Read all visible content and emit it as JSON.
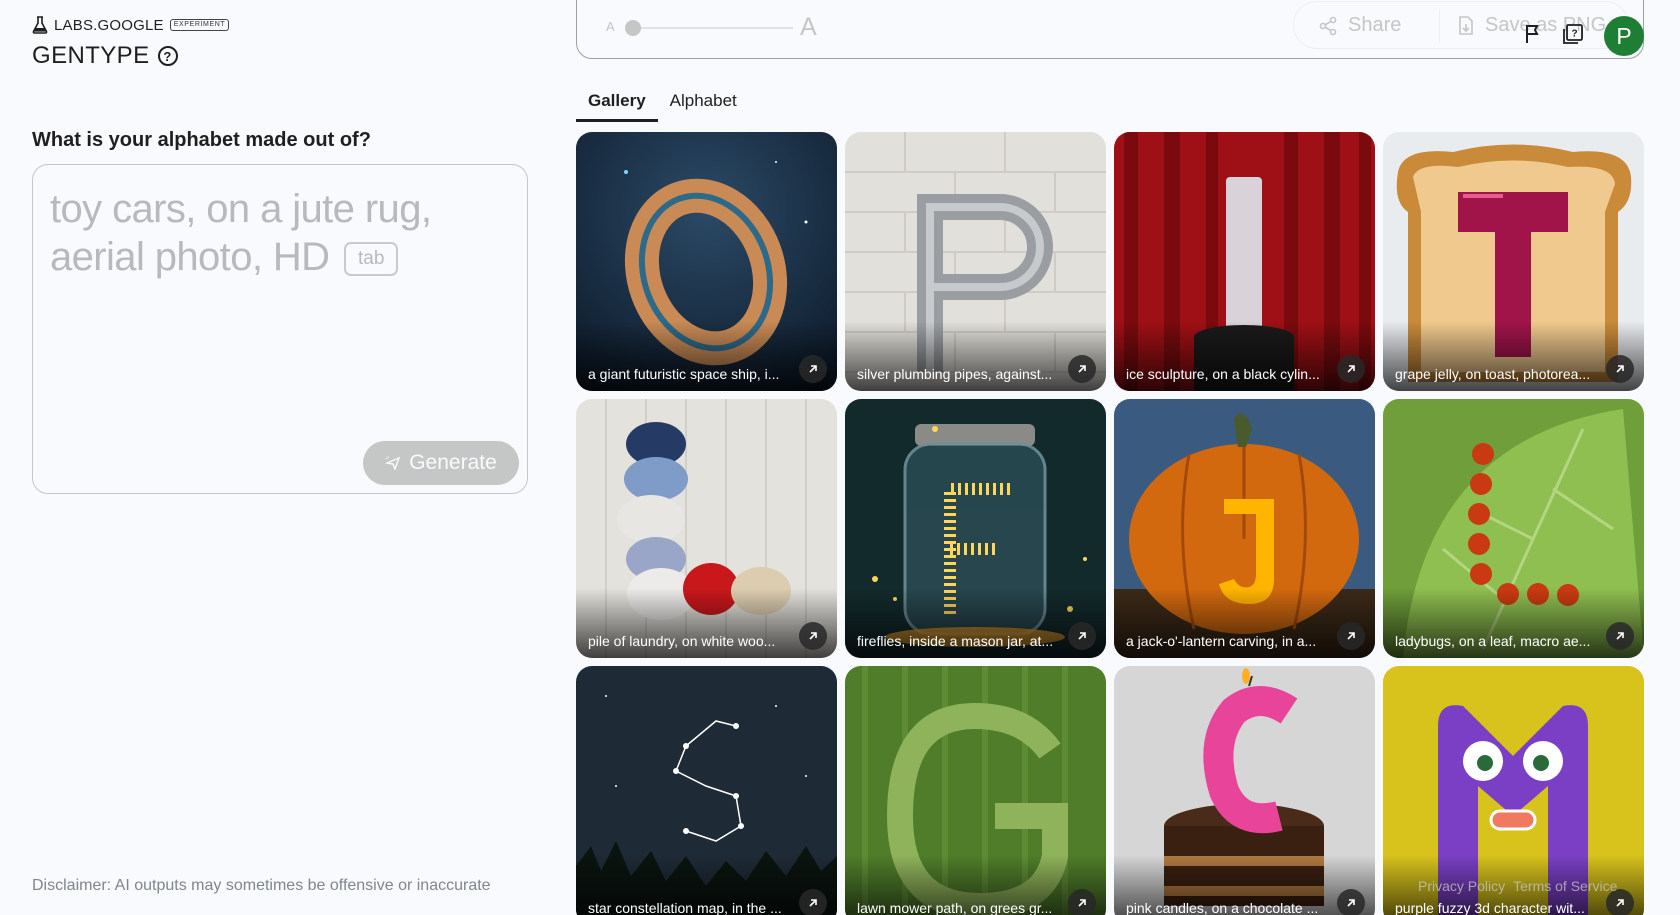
{
  "brand": {
    "name": "LABS.GOOGLE",
    "badge": "EXPERIMENT"
  },
  "app": {
    "title": "GENTYPE"
  },
  "prompt": {
    "question": "What is your alphabet made out of?",
    "placeholder": "toy cars, on a jute rug, aerial photo, HD",
    "tab_hint": "tab",
    "generate_label": "Generate"
  },
  "toolbar": {
    "size_small": "A",
    "size_large": "A",
    "size_level": 0.03,
    "share_label": "Share",
    "save_label": "Save as PNG"
  },
  "user": {
    "avatar_letter": "P"
  },
  "tabs": [
    {
      "label": "Gallery",
      "active": true
    },
    {
      "label": "Alphabet",
      "active": false
    }
  ],
  "gallery": [
    {
      "letter": "O",
      "caption": "a giant futuristic space ship, i..."
    },
    {
      "letter": "P",
      "caption": "silver plumbing pipes, against..."
    },
    {
      "letter": "I",
      "caption": "ice sculpture, on a black cylin..."
    },
    {
      "letter": "T",
      "caption": "grape jelly, on toast, photorea..."
    },
    {
      "letter": "L",
      "caption": "pile of laundry, on white woo..."
    },
    {
      "letter": "F",
      "caption": "fireflies, inside a mason jar, at..."
    },
    {
      "letter": "J",
      "caption": "a jack-o'-lantern carving, in a..."
    },
    {
      "letter": "L",
      "caption": "ladybugs, on a leaf, macro ae..."
    },
    {
      "letter": "S",
      "caption": "star constellation map, in the ..."
    },
    {
      "letter": "G",
      "caption": "lawn mower path, on grees gr..."
    },
    {
      "letter": "C",
      "caption": "pink candles, on a chocolate ..."
    },
    {
      "letter": "M",
      "caption": "purple fuzzy 3d character wit..."
    }
  ],
  "disclaimer": "Disclaimer: AI outputs may sometimes be offensive or inaccurate",
  "footer": {
    "privacy": "Privacy Policy",
    "terms": "Terms of Service"
  }
}
